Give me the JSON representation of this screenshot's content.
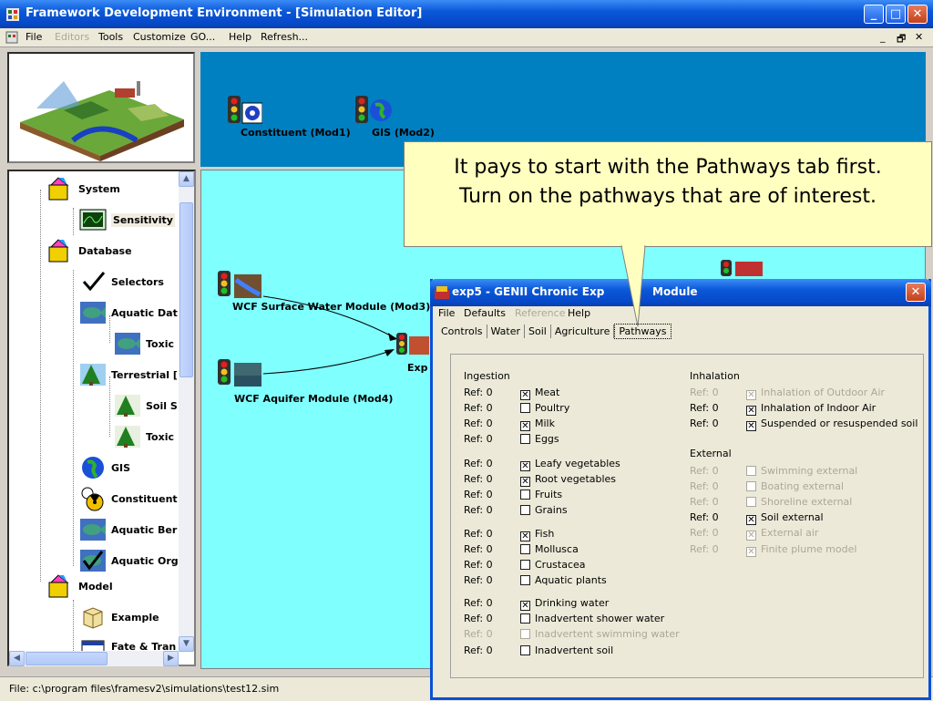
{
  "window": {
    "title": "Framework Development Environment - [Simulation Editor]",
    "min": "_",
    "max": "□",
    "close": "✕",
    "mdi_controls": [
      "_",
      "🗗",
      "✕"
    ]
  },
  "menubar": [
    "File",
    "Editors",
    "Tools",
    "Customize",
    "GO...",
    "Help",
    "Refresh..."
  ],
  "tree": {
    "items": [
      {
        "label": "System",
        "level": 0
      },
      {
        "label": "Sensitivity",
        "level": 1
      },
      {
        "label": "Database",
        "level": 0
      },
      {
        "label": "Selectors",
        "level": 1
      },
      {
        "label": "Aquatic Dat",
        "level": 1
      },
      {
        "label": "Toxic",
        "level": 2
      },
      {
        "label": "Terrestrial [",
        "level": 1
      },
      {
        "label": "Soil S",
        "level": 2
      },
      {
        "label": "Toxic",
        "level": 2
      },
      {
        "label": "GIS",
        "level": 1
      },
      {
        "label": "Constituent",
        "level": 1
      },
      {
        "label": "Aquatic Ber",
        "level": 1
      },
      {
        "label": "Aquatic Org",
        "level": 1
      },
      {
        "label": "Model",
        "level": 0
      },
      {
        "label": "Example",
        "level": 1
      },
      {
        "label": "Fate & Tran",
        "level": 1
      }
    ]
  },
  "top_canvas": {
    "modules": [
      "Constituent (Mod1)",
      "GIS (Mod2)"
    ]
  },
  "main_canvas": {
    "modules": [
      "WCF Surface Water Module (Mod3)",
      "WCF Aquifer Module (Mod4)",
      "Exp"
    ]
  },
  "status": "File: c:\\program files\\framesv2\\simulations\\test12.sim",
  "callout": {
    "line1": "It pays to start with the Pathways tab first.",
    "line2": "Turn on the pathways that are of interest."
  },
  "dialog": {
    "title": "exp5 - GENII Chronic Exp",
    "title_end": "Module",
    "menu": [
      "File",
      "Defaults",
      "Reference",
      "Help"
    ],
    "tabs": [
      "Controls",
      "Water",
      "Soil",
      "Agriculture",
      "Pathways"
    ],
    "active_tab": "Pathways",
    "ingestion": {
      "header": "Ingestion",
      "groups": [
        [
          {
            "ref": "Ref: 0",
            "label": "Meat",
            "checked": true
          },
          {
            "ref": "Ref: 0",
            "label": "Poultry",
            "checked": false
          },
          {
            "ref": "Ref: 0",
            "label": "Milk",
            "checked": true
          },
          {
            "ref": "Ref: 0",
            "label": "Eggs",
            "checked": false
          }
        ],
        [
          {
            "ref": "Ref: 0",
            "label": "Leafy vegetables",
            "checked": true
          },
          {
            "ref": "Ref: 0",
            "label": "Root vegetables",
            "checked": true
          },
          {
            "ref": "Ref: 0",
            "label": "Fruits",
            "checked": false
          },
          {
            "ref": "Ref: 0",
            "label": "Grains",
            "checked": false
          }
        ],
        [
          {
            "ref": "Ref: 0",
            "label": "Fish",
            "checked": true
          },
          {
            "ref": "Ref: 0",
            "label": "Mollusca",
            "checked": false
          },
          {
            "ref": "Ref: 0",
            "label": "Crustacea",
            "checked": false
          },
          {
            "ref": "Ref: 0",
            "label": "Aquatic plants",
            "checked": false
          }
        ],
        [
          {
            "ref": "Ref: 0",
            "label": "Drinking water",
            "checked": true
          },
          {
            "ref": "Ref: 0",
            "label": "Inadvertent shower water",
            "checked": false
          },
          {
            "ref": "Ref: 0",
            "label": "Inadvertent swimming water",
            "checked": false,
            "disabled": true
          },
          {
            "ref": "Ref: 0",
            "label": "Inadvertent soil",
            "checked": false
          }
        ]
      ]
    },
    "inhalation": {
      "header": "Inhalation",
      "items": [
        {
          "ref": "Ref: 0",
          "label": "Inhalation of Outdoor Air",
          "checked": true,
          "disabled": true
        },
        {
          "ref": "Ref: 0",
          "label": "Inhalation of Indoor Air",
          "checked": true
        },
        {
          "ref": "Ref: 0",
          "label": "Suspended or resuspended soil",
          "checked": true
        }
      ]
    },
    "external": {
      "header": "External",
      "items": [
        {
          "ref": "Ref: 0",
          "label": "Swimming external",
          "checked": false,
          "disabled": true
        },
        {
          "ref": "Ref: 0",
          "label": "Boating external",
          "checked": false,
          "disabled": true
        },
        {
          "ref": "Ref: 0",
          "label": "Shoreline external",
          "checked": false,
          "disabled": true
        },
        {
          "ref": "Ref: 0",
          "label": "Soil external",
          "checked": true
        },
        {
          "ref": "Ref: 0",
          "label": "External air",
          "checked": true,
          "disabled": true
        },
        {
          "ref": "Ref: 0",
          "label": "Finite plume model",
          "checked": true,
          "disabled": true
        }
      ]
    }
  }
}
